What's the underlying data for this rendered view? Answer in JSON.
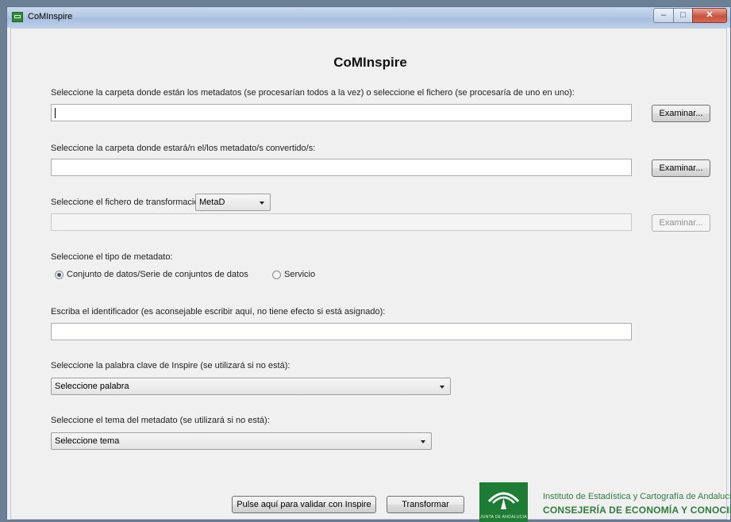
{
  "window": {
    "title": "CoMInspire",
    "controls": {
      "minimize": "–",
      "maximize": "□",
      "close": "✕"
    }
  },
  "heading": "CoMInspire",
  "source": {
    "label": "Seleccione la carpeta donde están los metadatos (se procesarían todos a la vez) o seleccione el fichero (se procesaría de uno en uno):",
    "value": "",
    "button": "Examinar..."
  },
  "destination": {
    "label": "Seleccione la carpeta donde estará/n el/los metadato/s convertido/s:",
    "value": "",
    "button": "Examinar..."
  },
  "transform": {
    "label": "Seleccione el fichero de transformación:",
    "selected": "MetaD",
    "value": "",
    "button": "Examinar..."
  },
  "metadata_type": {
    "label": "Seleccione el tipo de metadato:",
    "options": [
      {
        "label": "Conjunto de datos/Serie de conjuntos de datos",
        "checked": true
      },
      {
        "label": "Servicio",
        "checked": false
      }
    ]
  },
  "identifier": {
    "label": "Escriba el identificador (es aconsejable escribir aquí, no tiene efecto si está asignado):",
    "value": ""
  },
  "keyword": {
    "label": "Seleccione la palabra clave de Inspire (se utilizará si no está):",
    "selected": "Seleccione palabra"
  },
  "theme": {
    "label": "Seleccione el tema del metadato (se utilizará si no está):",
    "selected": "Seleccione tema"
  },
  "actions": {
    "validate": "Pulse aquí para validar con Inspire",
    "transform": "Transformar"
  },
  "footer": {
    "logo_text": "JUNTA DE ANDALUCIA",
    "institute": "Instituto de Estadística y Cartografía de Andalucía",
    "department": "CONSEJERÍA DE ECONOMÍA Y CONOCIMIENTO"
  },
  "colors": {
    "brand_green": "#1e7d34",
    "text_green": "#2f7d3c"
  }
}
